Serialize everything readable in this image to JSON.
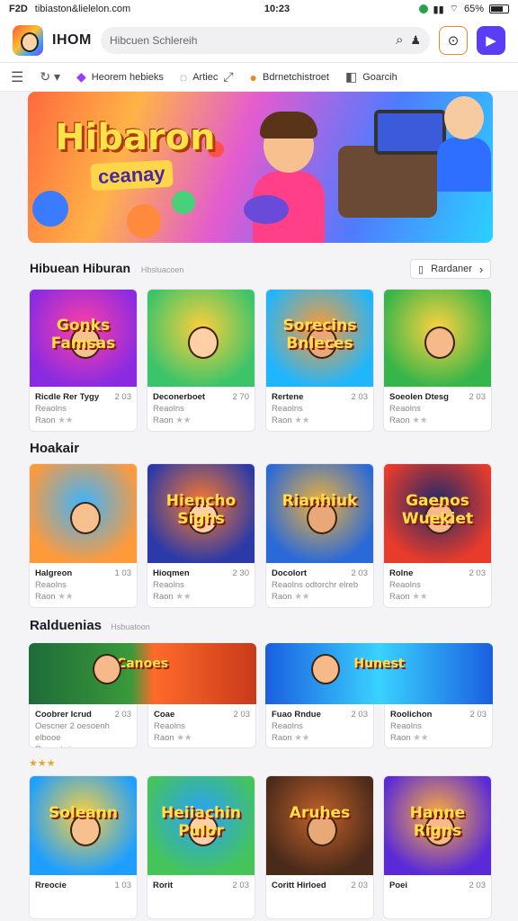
{
  "status": {
    "apps": "F2D",
    "url": "tibiaston&lielelon.com",
    "time": "10:23",
    "battery": "65%"
  },
  "header": {
    "brand": "IHOM",
    "search_placeholder": "Hibcuen Schlereih"
  },
  "nav": {
    "items": [
      "Heorem hebieks",
      "Artiec",
      "Bdrnetchistroet",
      "Goarcih"
    ]
  },
  "banner": {
    "title": "Hibaron",
    "subtitle": "ceanay"
  },
  "sections": [
    {
      "title": "Hibuean Hiburan",
      "subtitle": "Hbsluacoen",
      "see_all": "Rardaner",
      "cards": [
        {
          "thumb_text": "Gonks Famsas",
          "name": "Ricdle Rer Tygy",
          "num": "2 03",
          "category": "Reaolns",
          "rating_label": "Raon",
          "stars": "★★"
        },
        {
          "thumb_text": "",
          "name": "Deconerboet",
          "num": "2 70",
          "category": "Reaolns",
          "rating_label": "Raon",
          "stars": "★★"
        },
        {
          "thumb_text": "Sorecins Bnleces",
          "name": "Rertene",
          "num": "2 03",
          "category": "Reaolns",
          "rating_label": "Raon",
          "stars": "★★"
        },
        {
          "thumb_text": "",
          "name": "Soeolen Dtesg",
          "num": "2 03",
          "category": "Reaolns",
          "rating_label": "Raon",
          "stars": "★★"
        }
      ]
    },
    {
      "title": "Hoakair",
      "cards": [
        {
          "thumb_text": "",
          "name": "Halgreon",
          "num": "1 03",
          "category": "Reaolns",
          "rating_label": "Raon",
          "stars": "★★"
        },
        {
          "thumb_text": "Hiencho Sighs",
          "name": "Hioqmen",
          "num": "2 30",
          "category": "Reaolns",
          "rating_label": "Raon",
          "stars": "★★"
        },
        {
          "thumb_text": "Rianhiuk",
          "name": "Docolort",
          "num": "2 03",
          "category": "Reaolns odtorchr elreb",
          "rating_label": "Raon",
          "stars": "★★"
        },
        {
          "thumb_text": "Gaenos Wuekiet",
          "name": "Rolne",
          "num": "2 03",
          "category": "Reaolns",
          "rating_label": "Raon",
          "stars": "★★"
        }
      ]
    },
    {
      "title": "Ralduenias",
      "subtitle": "Hsbuatoon",
      "cards": [
        {
          "thumb_text": "Canoes",
          "name": "Coobrer Icrud",
          "num": "2 03",
          "category": "Oescner 2 oesoenh elbooe",
          "rating_label": "Raon",
          "stars": "★★"
        },
        {
          "thumb_text": "",
          "name": "Coae",
          "num": "2 03",
          "category": "Reaolns",
          "rating_label": "Raon",
          "stars": "★★"
        },
        {
          "thumb_text": "Hunest",
          "name": "Fuao Rndue",
          "num": "2 03",
          "category": "Reaolns",
          "rating_label": "Raon",
          "stars": "★★"
        },
        {
          "thumb_text": "",
          "name": "Roolichon",
          "num": "2 03",
          "category": "Reaolns",
          "rating_label": "Raon",
          "stars": "★★"
        }
      ]
    },
    {
      "title": "",
      "cards": [
        {
          "thumb_text": "Soleann",
          "name": "Rreocie",
          "num": "1 03",
          "category": "",
          "rating_label": "",
          "stars": ""
        },
        {
          "thumb_text": "Heiiachin Pulor",
          "name": "Rorit",
          "num": "2 03",
          "category": "",
          "rating_label": "",
          "stars": ""
        },
        {
          "thumb_text": "Aruhes",
          "name": "Coritt Hirloed",
          "num": "2 03",
          "category": "",
          "rating_label": "",
          "stars": ""
        },
        {
          "thumb_text": "Hanne Rigns",
          "name": "Poei",
          "num": "2 03",
          "category": "",
          "rating_label": "",
          "stars": ""
        }
      ]
    }
  ],
  "colors": {
    "accent": "#5b3df5",
    "orange": "#e9882a"
  }
}
